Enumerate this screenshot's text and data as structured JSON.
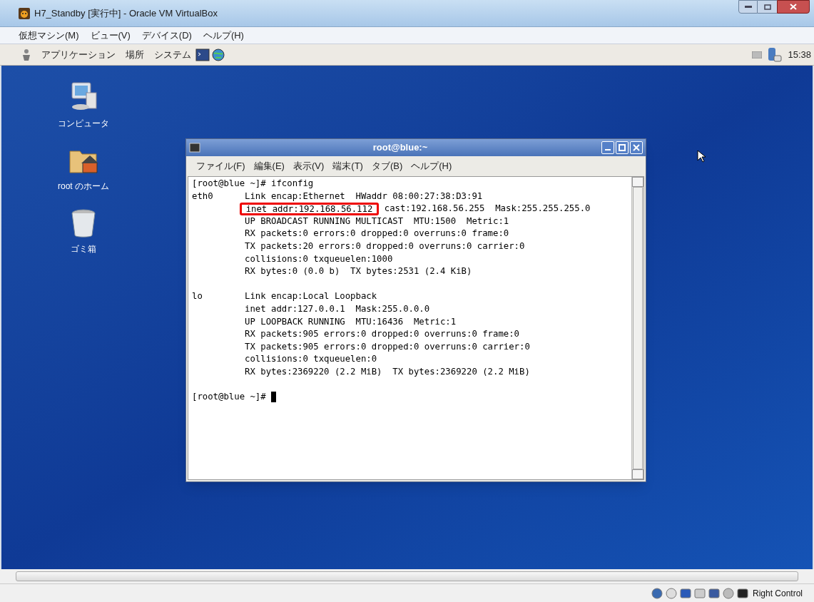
{
  "window": {
    "title": "H7_Standby [実行中] - Oracle VM VirtualBox"
  },
  "menu": [
    "仮想マシン(M)",
    "ビュー(V)",
    "デバイス(D)",
    "ヘルプ(H)"
  ],
  "panel": {
    "menus": [
      "アプリケーション",
      "場所",
      "システム"
    ],
    "clock": "15:38"
  },
  "desktop_icons": [
    {
      "kind": "computer",
      "label": "コンピュータ"
    },
    {
      "kind": "home",
      "label": "root のホーム"
    },
    {
      "kind": "trash",
      "label": "ゴミ箱"
    }
  ],
  "terminal": {
    "title": "root@blue:~",
    "menu": [
      "ファイル(F)",
      "編集(E)",
      "表示(V)",
      "端末(T)",
      "タブ(B)",
      "ヘルプ(H)"
    ],
    "lines": [
      {
        "kind": "text",
        "text": "[root@blue ~]# ifconfig"
      },
      {
        "kind": "text",
        "text": "eth0      Link encap:Ethernet  HWaddr 08:00:27:38:D3:91"
      },
      {
        "kind": "highlight",
        "highlight": "inet addr:192.168.56.112",
        "text": "cast:192.168.56.255  Mask:255.255.255.0"
      },
      {
        "kind": "text",
        "text": "          UP BROADCAST RUNNING MULTICAST  MTU:1500  Metric:1"
      },
      {
        "kind": "text",
        "text": "          RX packets:0 errors:0 dropped:0 overruns:0 frame:0"
      },
      {
        "kind": "text",
        "text": "          TX packets:20 errors:0 dropped:0 overruns:0 carrier:0"
      },
      {
        "kind": "text",
        "text": "          collisions:0 txqueuelen:1000"
      },
      {
        "kind": "text",
        "text": "          RX bytes:0 (0.0 b)  TX bytes:2531 (2.4 KiB)"
      },
      {
        "kind": "blank"
      },
      {
        "kind": "text",
        "text": "lo        Link encap:Local Loopback"
      },
      {
        "kind": "text",
        "text": "          inet addr:127.0.0.1  Mask:255.0.0.0"
      },
      {
        "kind": "text",
        "text": "          UP LOOPBACK RUNNING  MTU:16436  Metric:1"
      },
      {
        "kind": "text",
        "text": "          RX packets:905 errors:0 dropped:0 overruns:0 frame:0"
      },
      {
        "kind": "text",
        "text": "          TX packets:905 errors:0 dropped:0 overruns:0 carrier:0"
      },
      {
        "kind": "text",
        "text": "          collisions:0 txqueuelen:0"
      },
      {
        "kind": "text",
        "text": "          RX bytes:2369220 (2.2 MiB)  TX bytes:2369220 (2.2 MiB)"
      },
      {
        "kind": "blank"
      },
      {
        "kind": "prompt",
        "text": "[root@blue ~]# "
      }
    ]
  },
  "status_bar": {
    "host_key": "Right Control"
  }
}
